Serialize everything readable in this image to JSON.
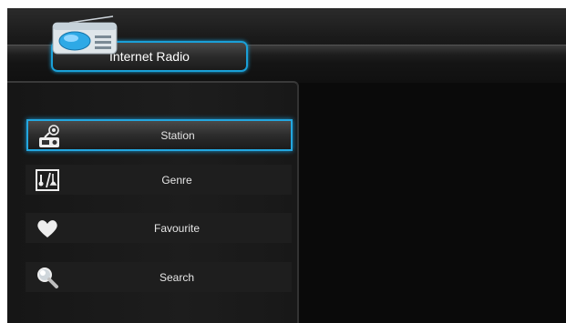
{
  "header": {
    "title": "Internet Radio",
    "icon": "radio-icon"
  },
  "menu": {
    "items": [
      {
        "label": "Station",
        "icon": "station-radio-icon",
        "selected": true
      },
      {
        "label": "Genre",
        "icon": "genre-icon",
        "selected": false
      },
      {
        "label": "Favourite",
        "icon": "heart-icon",
        "selected": false
      },
      {
        "label": "Search",
        "icon": "magnifier-icon",
        "selected": false
      }
    ]
  },
  "colors": {
    "accent": "#1aa0d8",
    "background": "#0c0c0c",
    "text": "#ffffff"
  }
}
